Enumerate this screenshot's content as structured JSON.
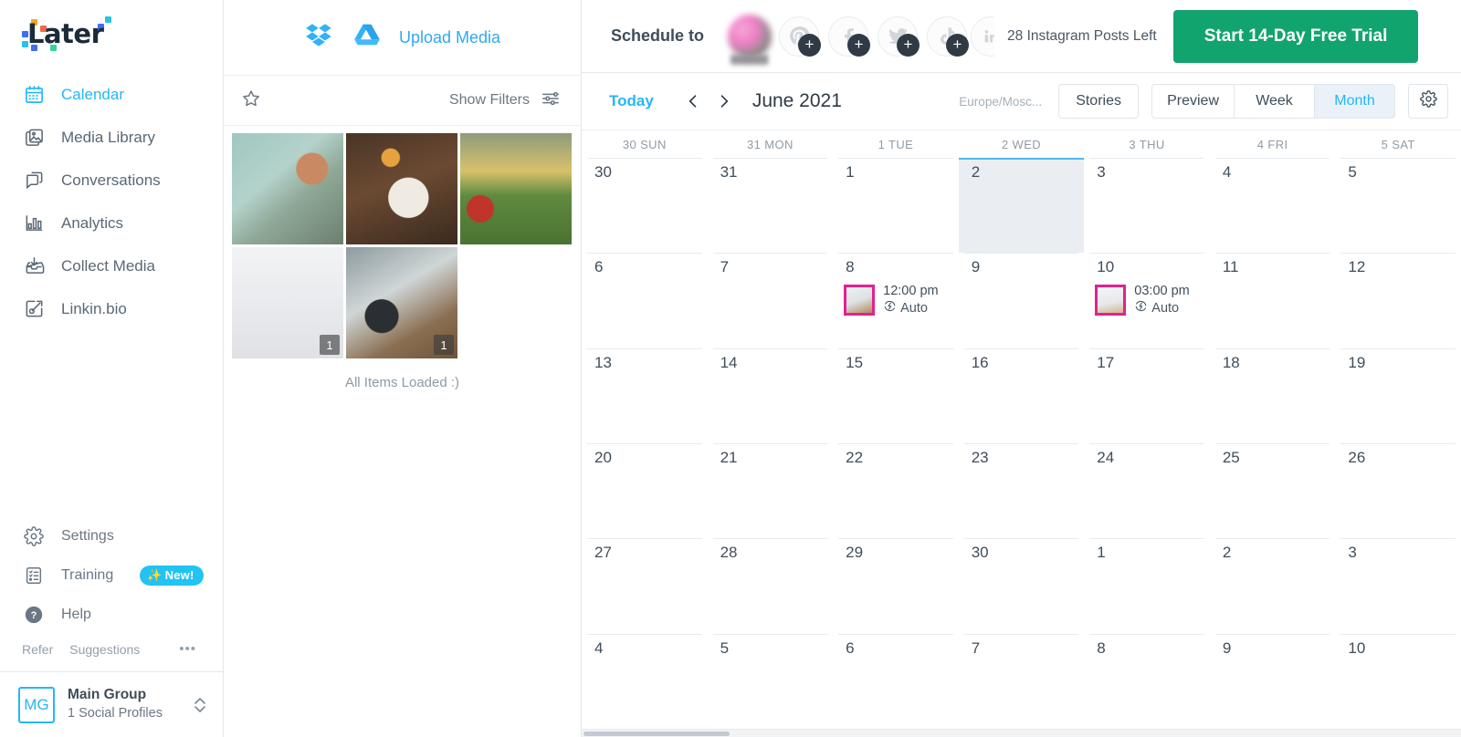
{
  "brand": {
    "name": "Later",
    "accent": "#26b7f5",
    "green": "#12a46e",
    "magenta": "#e2218f"
  },
  "sidebar": {
    "nav": [
      {
        "label": "Calendar",
        "icon": "calendar-icon",
        "active": true
      },
      {
        "label": "Media Library",
        "icon": "media-library-icon",
        "active": false
      },
      {
        "label": "Conversations",
        "icon": "conversations-icon",
        "active": false
      },
      {
        "label": "Analytics",
        "icon": "analytics-icon",
        "active": false
      },
      {
        "label": "Collect Media",
        "icon": "collect-media-icon",
        "active": false
      },
      {
        "label": "Linkin.bio",
        "icon": "linkinbio-icon",
        "active": false
      }
    ],
    "bottom": [
      {
        "label": "Settings",
        "icon": "gear-icon",
        "badge": ""
      },
      {
        "label": "Training",
        "icon": "training-icon",
        "badge": "New!"
      },
      {
        "label": "Help",
        "icon": "help-icon",
        "badge": ""
      }
    ],
    "refer": "Refer",
    "suggestions": "Suggestions",
    "more": "•••",
    "group": {
      "initials": "MG",
      "name": "Main Group",
      "subtitle": "1 Social Profiles"
    }
  },
  "media": {
    "upload_label": "Upload Media",
    "dropbox_icon": "dropbox-icon",
    "gdrive_icon": "google-drive-icon",
    "star_icon": "star-icon",
    "filters_label": "Show Filters",
    "filters_icon": "sliders-icon",
    "all_loaded": "All Items Loaded :)",
    "thumbs": [
      {
        "alt": "picnic-basket-flatlay",
        "count": ""
      },
      {
        "alt": "hands-holding-mug",
        "count": ""
      },
      {
        "alt": "people-lying-on-grass",
        "count": ""
      },
      {
        "alt": "white-room-with-frames",
        "count": "1"
      },
      {
        "alt": "laptop-on-desk",
        "count": "1"
      }
    ]
  },
  "topbar": {
    "schedule_to": "Schedule to",
    "profiles": [
      {
        "type": "instagram-avatar",
        "name": "",
        "add": false
      },
      {
        "type": "pinterest-icon",
        "add": true
      },
      {
        "type": "facebook-icon",
        "add": true
      },
      {
        "type": "twitter-icon",
        "add": true
      },
      {
        "type": "tiktok-icon",
        "add": true
      },
      {
        "type": "linkedin-icon",
        "add": false
      }
    ],
    "posts_left": "28 Instagram Posts Left",
    "trial_button": "Start 14-Day Free Trial"
  },
  "calendar_toolbar": {
    "today": "Today",
    "prev_icon": "chevron-left-icon",
    "next_icon": "chevron-right-icon",
    "month_title": "June 2021",
    "timezone": "Europe/Mosc...",
    "stories": "Stories",
    "views": [
      {
        "label": "Preview",
        "selected": false
      },
      {
        "label": "Week",
        "selected": false
      },
      {
        "label": "Month",
        "selected": true
      }
    ],
    "settings_icon": "gear-icon"
  },
  "calendar": {
    "daynames": [
      "30 SUN",
      "31 MON",
      "1 TUE",
      "2 WED",
      "3 THU",
      "4 FRI",
      "5 SAT"
    ],
    "weeks": [
      [
        {
          "day": "30"
        },
        {
          "day": "31"
        },
        {
          "day": "1"
        },
        {
          "day": "2",
          "today": true
        },
        {
          "day": "3"
        },
        {
          "day": "4"
        },
        {
          "day": "5"
        }
      ],
      [
        {
          "day": "6"
        },
        {
          "day": "7"
        },
        {
          "day": "8",
          "events": [
            {
              "time": "12:00 pm",
              "auto": "Auto",
              "thumb": "im-evt"
            }
          ]
        },
        {
          "day": "9"
        },
        {
          "day": "10",
          "events": [
            {
              "time": "03:00 pm",
              "auto": "Auto",
              "thumb": "im-evt2"
            }
          ]
        },
        {
          "day": "11"
        },
        {
          "day": "12"
        }
      ],
      [
        {
          "day": "13"
        },
        {
          "day": "14"
        },
        {
          "day": "15"
        },
        {
          "day": "16"
        },
        {
          "day": "17"
        },
        {
          "day": "18"
        },
        {
          "day": "19"
        }
      ],
      [
        {
          "day": "20"
        },
        {
          "day": "21"
        },
        {
          "day": "22"
        },
        {
          "day": "23"
        },
        {
          "day": "24"
        },
        {
          "day": "25"
        },
        {
          "day": "26"
        }
      ],
      [
        {
          "day": "27"
        },
        {
          "day": "28"
        },
        {
          "day": "29"
        },
        {
          "day": "30"
        },
        {
          "day": "1"
        },
        {
          "day": "2"
        },
        {
          "day": "3"
        }
      ],
      [
        {
          "day": "4"
        },
        {
          "day": "5"
        },
        {
          "day": "6"
        },
        {
          "day": "7"
        },
        {
          "day": "8"
        },
        {
          "day": "9"
        },
        {
          "day": "10"
        }
      ]
    ]
  }
}
